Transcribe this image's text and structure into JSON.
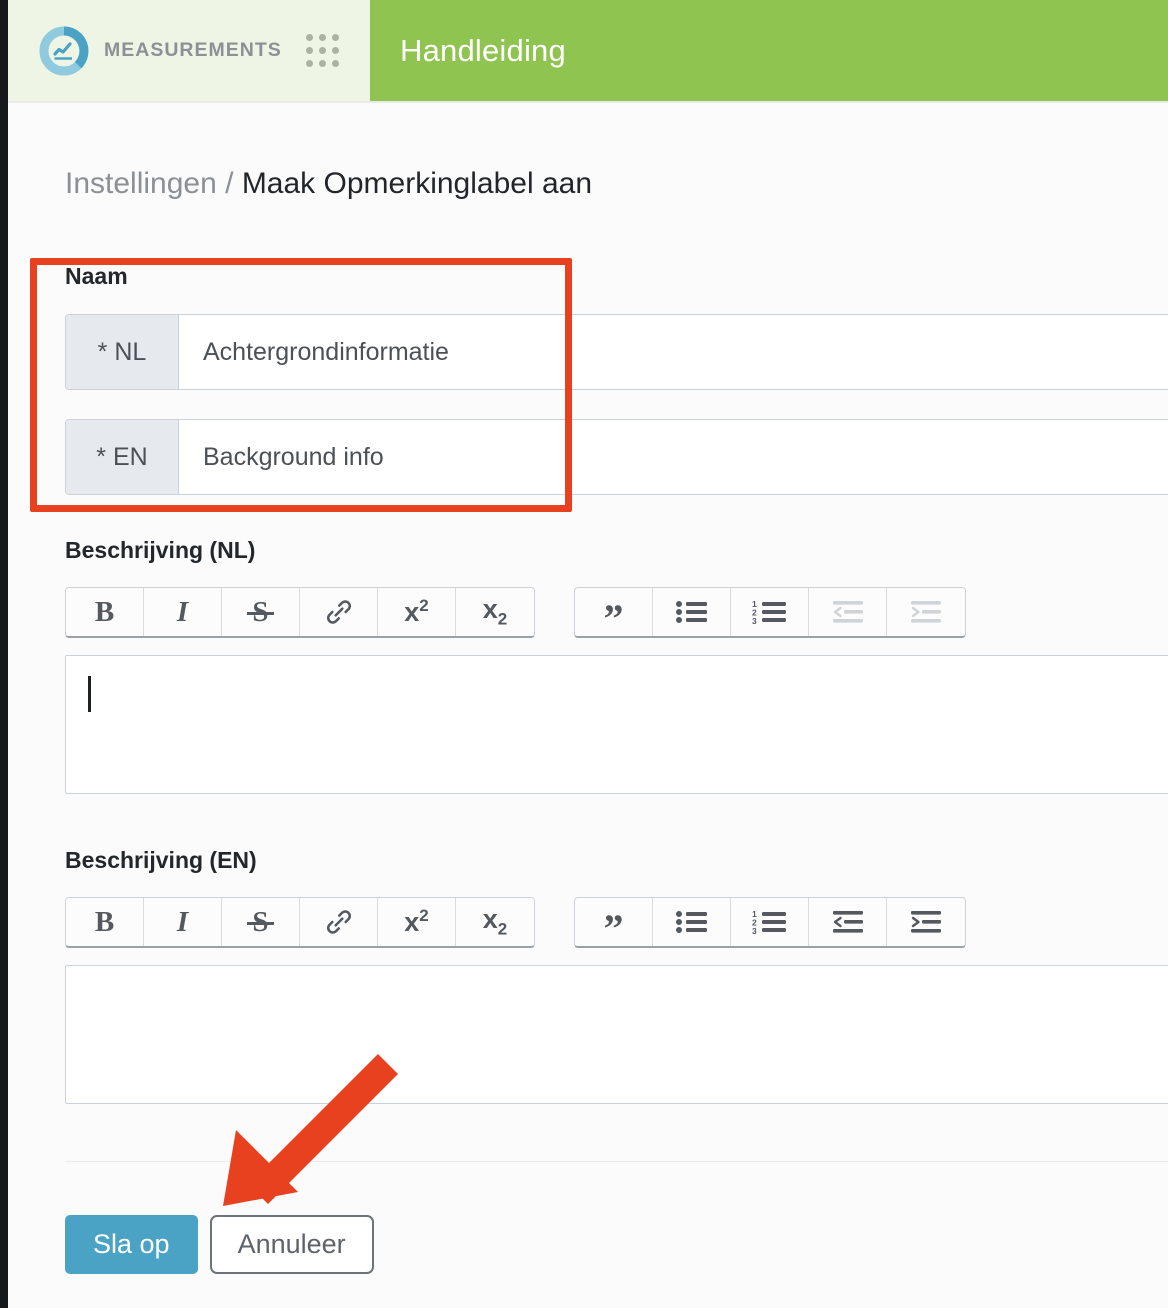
{
  "header": {
    "brand_name": "MEASUREMENTS",
    "logo_icon": "measurements-donut-chart-logo",
    "app_grid_icon": "app-grid-icon",
    "active_tab": "Handleiding"
  },
  "breadcrumb": {
    "parent": "Instellingen",
    "separator": "/",
    "current": "Maak Opmerkinglabel aan"
  },
  "form": {
    "naam_label": "Naam",
    "name_rows": [
      {
        "prefix": "* NL",
        "value": "Achtergrondinformatie"
      },
      {
        "prefix": "* EN",
        "value": "Background info"
      }
    ],
    "description_nl": {
      "heading": "Beschrijving (NL)",
      "content": ""
    },
    "description_en": {
      "heading": "Beschrijving (EN)",
      "content": ""
    }
  },
  "toolbar": {
    "group1": [
      {
        "icon": "bold-icon",
        "label": "B"
      },
      {
        "icon": "italic-icon",
        "label": "I"
      },
      {
        "icon": "strikethrough-icon",
        "label": "S"
      },
      {
        "icon": "link-icon",
        "label": ""
      },
      {
        "icon": "superscript-icon",
        "label": "x"
      },
      {
        "icon": "subscript-icon",
        "label": "x"
      }
    ],
    "group2": [
      {
        "icon": "blockquote-icon",
        "label": "”"
      },
      {
        "icon": "bullet-list-icon",
        "label": ""
      },
      {
        "icon": "numbered-list-icon",
        "label": ""
      },
      {
        "icon": "outdent-icon",
        "label": ""
      },
      {
        "icon": "indent-icon",
        "label": ""
      }
    ],
    "superscript_exponent": "2",
    "subscript_index": "2",
    "numbered_list_digits": [
      "1",
      "2",
      "3"
    ]
  },
  "actions": {
    "save_label": "Sla op",
    "cancel_label": "Annuleer"
  },
  "annotations": {
    "highlight_rect": "red-rectangle-around-naam-fields",
    "arrow": "red-arrow-pointing-to-save-button"
  },
  "colors": {
    "nav_green": "#8ec44f",
    "brand_bg": "#eef5e4",
    "annotation_red": "#e8411f",
    "primary_button": "#4aa3c4",
    "logo_blue": "#7fc3dc",
    "logo_blue_dark": "#4aa3c4",
    "page_bg": "#fbfbfb"
  }
}
